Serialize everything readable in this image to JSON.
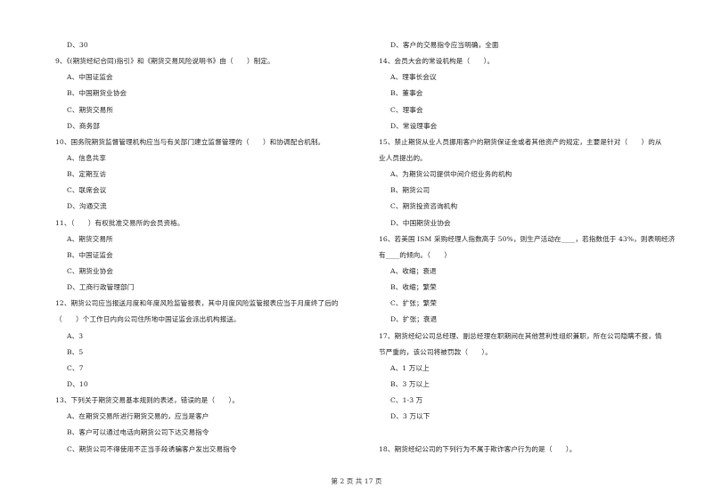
{
  "left_column": [
    {
      "type": "option",
      "text": "D、30"
    },
    {
      "type": "question",
      "text": "9、《(期货经纪合同)指引》和《期货交易风险说明书》由（　　）制定。"
    },
    {
      "type": "option",
      "text": "A、中国证监会"
    },
    {
      "type": "option",
      "text": "B、中国期货业协会"
    },
    {
      "type": "option",
      "text": "C、期货交易所"
    },
    {
      "type": "option",
      "text": "D、商务部"
    },
    {
      "type": "question",
      "text": "10、国务院期货监督管理机构应当与有关部门建立监督管理的（　　）和协调配合机制。"
    },
    {
      "type": "option",
      "text": "A、信息共享"
    },
    {
      "type": "option",
      "text": "B、定期互访"
    },
    {
      "type": "option",
      "text": "C、联席会议"
    },
    {
      "type": "option",
      "text": "D、沟通交流"
    },
    {
      "type": "question",
      "text": "11、（　　）有权批准交易所的会员资格。"
    },
    {
      "type": "option",
      "text": "A、期货交易所"
    },
    {
      "type": "option",
      "text": "B、中国证监会"
    },
    {
      "type": "option",
      "text": "C、期货业协会"
    },
    {
      "type": "option",
      "text": "D、工商行政管理部门"
    },
    {
      "type": "question",
      "text": "12、期货公司应当报送月度和年度风险监管报表，其中月度风险监管报表应当于月度终了后的"
    },
    {
      "type": "question",
      "text": "（　　）个工作日内向公司住所地中国证监会派出机构报送。"
    },
    {
      "type": "option",
      "text": "A、3"
    },
    {
      "type": "option",
      "text": "B、5"
    },
    {
      "type": "option",
      "text": "C、7"
    },
    {
      "type": "option",
      "text": "D、10"
    },
    {
      "type": "question",
      "text": "13、下列关于期货交易基本规则的表述，错误的是（　　）。"
    },
    {
      "type": "option",
      "text": "A、在期货交易所进行期货交易的，应当是客户"
    },
    {
      "type": "option",
      "text": "B、客户可以通过电话向期货公司下达交易指令"
    },
    {
      "type": "option",
      "text": "C、期货公司不得使用不正当手段诱骗客户发出交易指令"
    }
  ],
  "right_column": [
    {
      "type": "option",
      "text": "D、客户的交易指令应当明确，全面"
    },
    {
      "type": "question",
      "text": "14、会员大会的常设机构是（　　）。"
    },
    {
      "type": "option",
      "text": "A、理事长会议"
    },
    {
      "type": "option",
      "text": "B、董事会"
    },
    {
      "type": "option",
      "text": "C、理事会"
    },
    {
      "type": "option",
      "text": "D、常设理事会"
    },
    {
      "type": "question",
      "text": "15、禁止期货从业人员挪用客户的期货保证金或者其他资产的规定，主要是针对（　　）的从"
    },
    {
      "type": "question",
      "text": "业人员提出的。"
    },
    {
      "type": "option",
      "text": "A、为期货公司提供中间介绍业务的机构"
    },
    {
      "type": "option",
      "text": "B、期货公司"
    },
    {
      "type": "option",
      "text": "C、期货投资咨询机构"
    },
    {
      "type": "option",
      "text": "D、中国期货业协会"
    },
    {
      "type": "question",
      "text": "16、若美国 ISM 采购经理人指数高于 50%，则生产活动在____，若指数低于 43%，则表明经济"
    },
    {
      "type": "question",
      "text": "有____的倾向。（　　）"
    },
    {
      "type": "option",
      "text": "A、收缩；衰退"
    },
    {
      "type": "option",
      "text": "B、收缩；繁荣"
    },
    {
      "type": "option",
      "text": "C、扩张；繁荣"
    },
    {
      "type": "option",
      "text": "D、扩张；衰退"
    },
    {
      "type": "question",
      "text": "17、期货经纪公司总经理、副总经理在职期间在其他营利性组织兼职，所在公司隐瞒不报，情"
    },
    {
      "type": "question",
      "text": "节严重的，该公司将被罚款（　　）。"
    },
    {
      "type": "option",
      "text": "A、1 万以上"
    },
    {
      "type": "option",
      "text": "B、3 万以上"
    },
    {
      "type": "option",
      "text": "C、1-3 万"
    },
    {
      "type": "option",
      "text": "D、3 万以下"
    },
    {
      "type": "gap",
      "text": ""
    },
    {
      "type": "question",
      "text": "18、期货经纪公司的下列行为不属于欺诈客户行为的是（　　）。"
    }
  ],
  "footer": {
    "page_label": "第 2 页 共 17 页"
  }
}
